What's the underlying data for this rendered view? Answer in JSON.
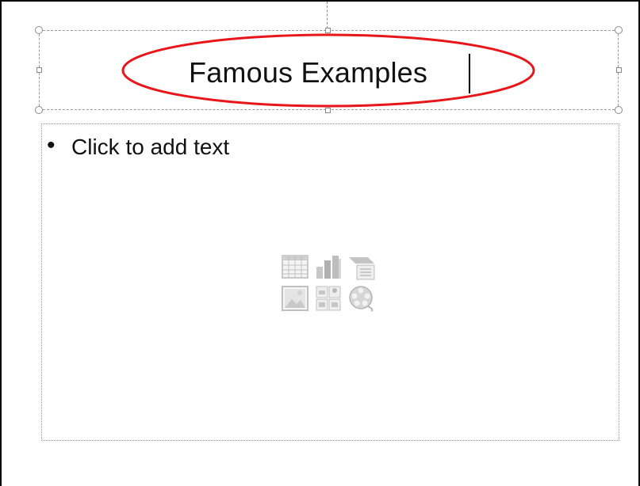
{
  "slide": {
    "title": "Famous Examples",
    "body_bullet": "•",
    "body_placeholder": "Click to add text"
  },
  "placeholder_icons": [
    "table-icon",
    "chart-icon",
    "smartart-icon",
    "picture-icon",
    "clip-art-icon",
    "media-clip-icon"
  ],
  "colors": {
    "annotation_ellipse": "#e8161b",
    "icon_gray": "#bdbdbd"
  }
}
